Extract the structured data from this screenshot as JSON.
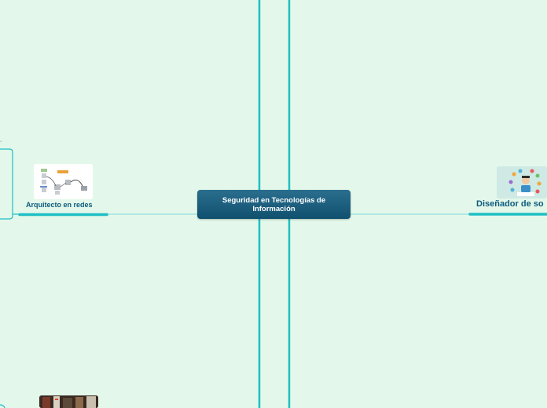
{
  "central_topic": {
    "title": "Seguridad en Tecnologías de Información"
  },
  "topics": [
    {
      "label": "Arquitecto en redes",
      "image": "network-diagram-image"
    },
    {
      "label": "Diseñador de so",
      "image": "software-designer-image"
    },
    {
      "label": "",
      "image": "server-room-image"
    }
  ],
  "colors": {
    "background": "#e3f8ea",
    "connector": "#1fbfc4",
    "central_fill": "#11506f",
    "label_text": "#0c5a7c"
  }
}
